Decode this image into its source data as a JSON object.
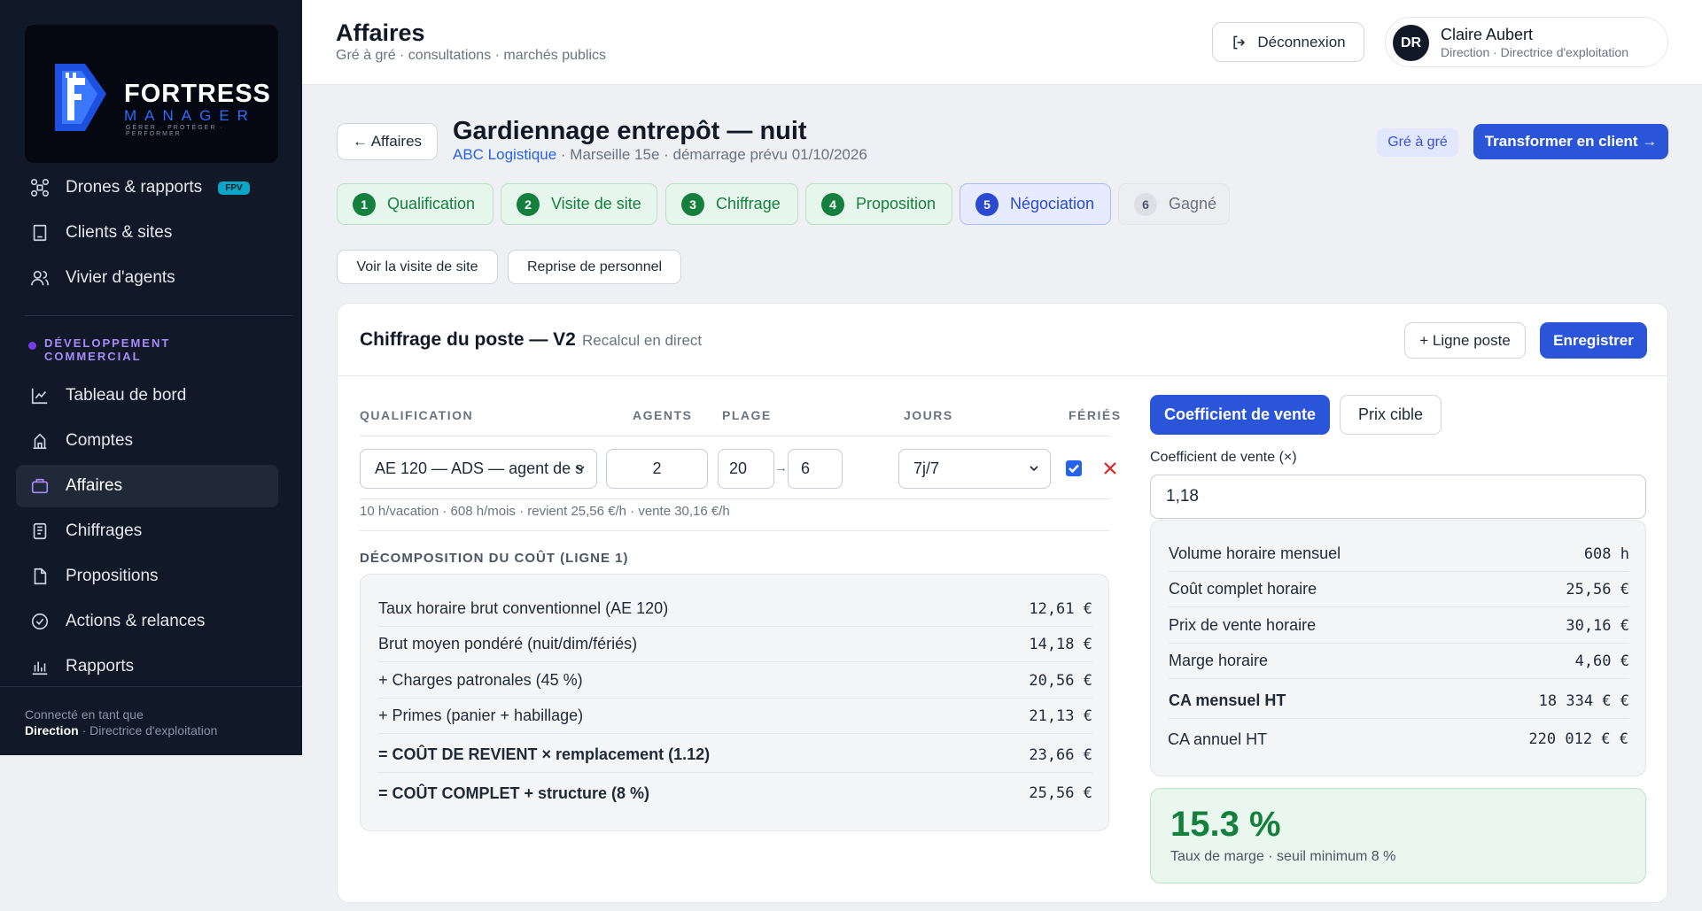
{
  "sidebar": {
    "logo": {
      "name": "FORTRESS",
      "sub": "MANAGER",
      "tagline": "GÉRER · PROTÉGER · PERFORMER"
    },
    "top_items": [
      {
        "label": "Drones & rapports",
        "badge": "FPV",
        "icon": "drone-icon"
      },
      {
        "label": "Clients & sites",
        "icon": "building-icon"
      },
      {
        "label": "Vivier d'agents",
        "icon": "users-icon"
      }
    ],
    "section_label": "DÉVELOPPEMENT COMMERCIAL",
    "items": [
      {
        "label": "Tableau de bord",
        "icon": "chart-line-icon"
      },
      {
        "label": "Comptes",
        "icon": "bank-icon"
      },
      {
        "label": "Affaires",
        "icon": "briefcase-icon",
        "active": true
      },
      {
        "label": "Chiffrages",
        "icon": "calculator-icon"
      },
      {
        "label": "Propositions",
        "icon": "file-icon"
      },
      {
        "label": "Actions & relances",
        "icon": "check-circle-icon"
      },
      {
        "label": "Rapports",
        "icon": "bar-chart-icon"
      }
    ],
    "footer": {
      "line1": "Connecté en tant que",
      "role": "Direction",
      "detail": " · Directrice d'exploitation"
    }
  },
  "header": {
    "title": "Affaires",
    "subtitle": "Gré à gré · consultations · marchés publics",
    "logout_label": "Déconnexion",
    "user": {
      "initials": "DR",
      "name": "Claire Aubert",
      "role": "Direction · Directrice d'exploitation"
    }
  },
  "deal": {
    "back_label": "← Affaires",
    "title": "Gardiennage entrepôt — nuit",
    "client": "ABC Logistique",
    "meta": " · Marseille 15e · démarrage prévu 01/10/2026",
    "tag": "Gré à gré",
    "transform_label": "Transformer en client →"
  },
  "steps": [
    {
      "num": "1",
      "label": "Qualification",
      "state": "done"
    },
    {
      "num": "2",
      "label": "Visite de site",
      "state": "done"
    },
    {
      "num": "3",
      "label": "Chiffrage",
      "state": "done"
    },
    {
      "num": "4",
      "label": "Proposition",
      "state": "done"
    },
    {
      "num": "5",
      "label": "Négociation",
      "state": "current"
    },
    {
      "num": "6",
      "label": "Gagné",
      "state": "todo"
    }
  ],
  "actions": {
    "visit_label": "Voir la visite de site",
    "staff_label": "Reprise de personnel"
  },
  "card": {
    "title": "Chiffrage du poste — V2",
    "note": "Recalcul en direct",
    "add_line_label": "+ Ligne poste",
    "save_label": "Enregistrer",
    "columns": {
      "qualification": "QUALIFICATION",
      "agents": "AGENTS",
      "plage": "PLAGE",
      "jours": "JOURS",
      "feries": "FÉRIÉS"
    },
    "line": {
      "qualification": "AE 120 — ADS — agent de s",
      "agents": "2",
      "plage_start": "20",
      "plage_arrow": "→",
      "plage_end": "6",
      "jours": "7j/7",
      "feries_checked": true,
      "info": "10 h/vacation · 608 h/mois · revient 25,56 €/h · vente 30,16 €/h"
    },
    "breakdown_title": "DÉCOMPOSITION DU COÛT (LIGNE 1)",
    "breakdown": [
      {
        "label": "Taux horaire brut conventionnel (AE 120)",
        "value": "12,61 €"
      },
      {
        "label": "Brut moyen pondéré (nuit/dim/fériés)",
        "value": "14,18 €"
      },
      {
        "label": "+ Charges patronales (45 %)",
        "value": "20,56 €"
      },
      {
        "label": "+ Primes (panier + habillage)",
        "value": "21,13 €"
      },
      {
        "label": "= COÛT DE REVIENT × remplacement (1.12)",
        "value": "23,66 €"
      },
      {
        "label": "= COÛT COMPLET + structure (8 %)",
        "value": "25,56 €"
      }
    ],
    "pricing": {
      "tab_active": "Coefficient de vente",
      "tab_other": "Prix cible",
      "coef_label": "Coefficient de vente (×)",
      "coef_value": "1,18",
      "summary": [
        {
          "label": "Volume horaire mensuel",
          "value": "608 h"
        },
        {
          "label": "Coût complet horaire",
          "value": "25,56 €"
        },
        {
          "label": "Prix de vente horaire",
          "value": "30,16 €"
        },
        {
          "label": "Marge horaire",
          "value": "4,60 €"
        },
        {
          "label": "CA mensuel HT",
          "value": "18 334 € €"
        },
        {
          "label": "CA annuel HT",
          "value": "220 012 € €"
        }
      ],
      "margin_value": "15.3 %",
      "margin_sub": "Taux de marge · seuil minimum 8 %"
    }
  },
  "colors": {
    "sidebar": "#111827",
    "accent": "#2b55d8",
    "success": "#15803d",
    "purple": "#a78bfa"
  }
}
